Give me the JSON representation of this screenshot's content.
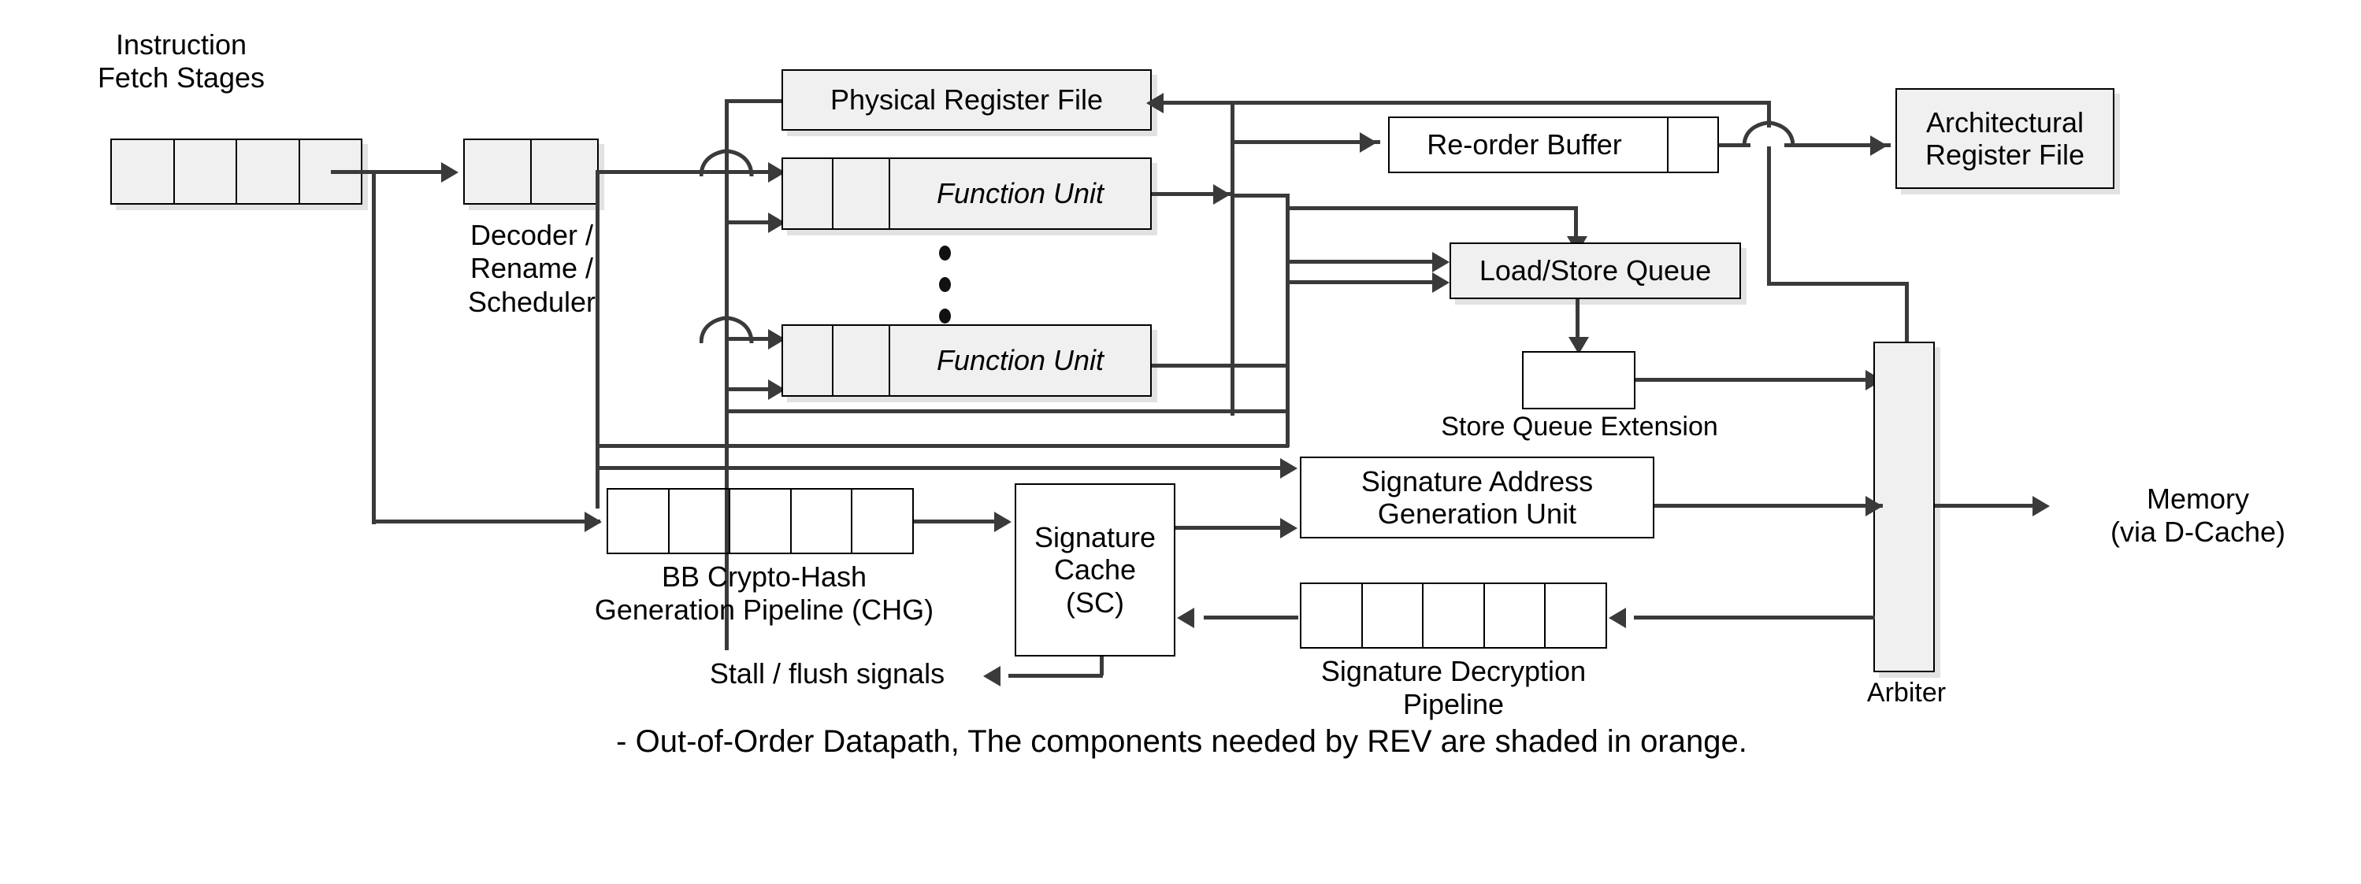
{
  "figure": {
    "caption": "- Out-of-Order Datapath, The components needed by REV are shaded in orange.",
    "colors": {
      "shade": "#f0f0f0",
      "line": "#3a3a3a",
      "shadow": "#e2e2e2",
      "text": "#000000"
    }
  },
  "blocks": {
    "instruction_fetch": {
      "label": "Instruction\nFetch Stages",
      "cells": 4,
      "shaded": true
    },
    "decoder": {
      "label": "Decoder /\nRename /\nScheduler",
      "cells": 2,
      "shaded": true
    },
    "physical_register_file": {
      "label": "Physical Register File",
      "shaded": true
    },
    "function_unit_top": {
      "label": "Function Unit",
      "cells": 2,
      "shaded": true
    },
    "function_unit_bottom": {
      "label": "Function Unit",
      "cells": 2,
      "shaded": true
    },
    "reorder_buffer": {
      "label": "Re-order Buffer",
      "shaded": false
    },
    "architectural_register_file": {
      "label": "Architectural\nRegister File",
      "shaded": true
    },
    "load_store_queue": {
      "label": "Load/Store Queue",
      "shaded": true
    },
    "store_queue_extension": {
      "label": "Store Queue Extension",
      "shaded": false
    },
    "signature_address_generation_unit": {
      "label": "Signature Address\nGeneration Unit",
      "shaded": false
    },
    "bb_crypto_hash": {
      "label": "BB Crypto-Hash\nGeneration Pipeline (CHG)",
      "cells": 5,
      "shaded": false
    },
    "signature_cache": {
      "label": "Signature\nCache\n(SC)",
      "shaded": false
    },
    "signature_decryption_pipeline": {
      "label": "Signature Decryption\nPipeline",
      "cells": 5,
      "shaded": false
    },
    "arbiter": {
      "label": "Arbiter",
      "shaded": true
    },
    "memory": {
      "label": "Memory\n(via D-Cache)"
    },
    "stall_flush": {
      "label": "Stall / flush signals"
    }
  }
}
